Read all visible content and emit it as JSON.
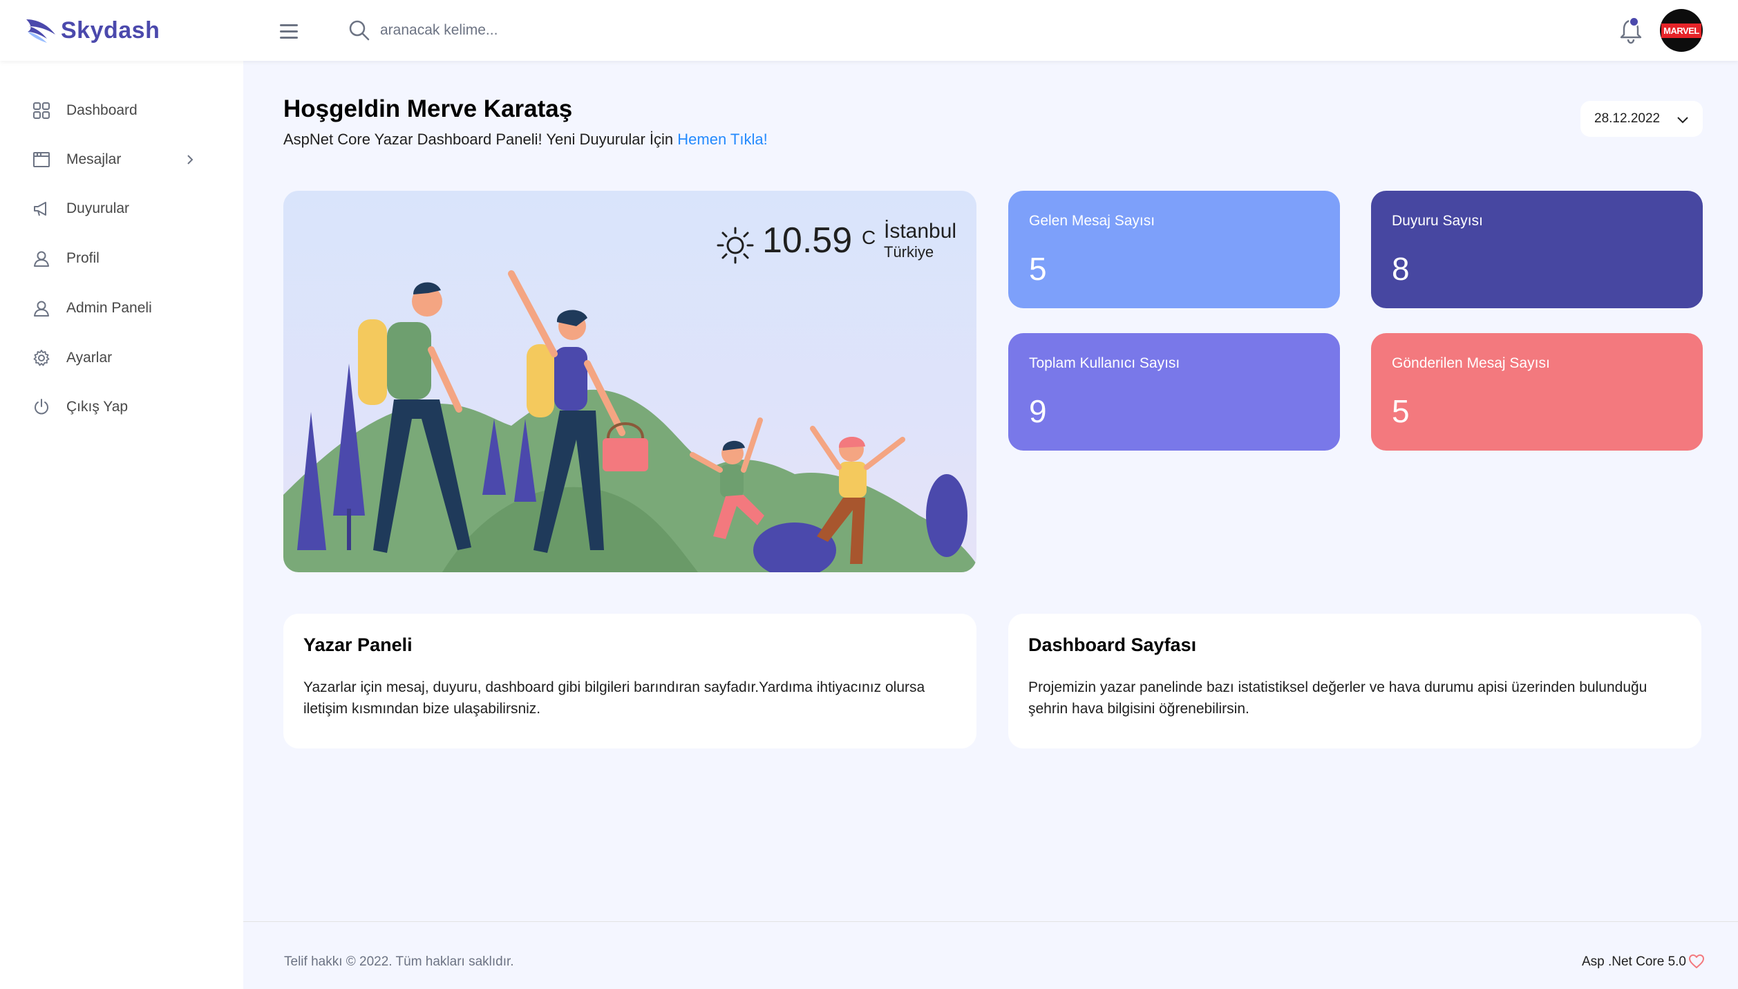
{
  "brand": {
    "name": "Skydash",
    "color": "#4b49ac"
  },
  "search": {
    "placeholder": "aranacak kelime..."
  },
  "avatar": {
    "badge": "MARVEL"
  },
  "sidebar": {
    "items": [
      {
        "label": "Dashboard",
        "icon": "grid-icon"
      },
      {
        "label": "Mesajlar",
        "icon": "browser-window-icon",
        "has_submenu": true
      },
      {
        "label": "Duyurular",
        "icon": "megaphone-icon"
      },
      {
        "label": "Profil",
        "icon": "user-icon"
      },
      {
        "label": "Admin Paneli",
        "icon": "user-icon"
      },
      {
        "label": "Ayarlar",
        "icon": "gear-icon"
      },
      {
        "label": "Çıkış Yap",
        "icon": "power-icon"
      }
    ]
  },
  "welcome": {
    "title": "Hoşgeldin Merve Karataş",
    "subtitle": "AspNet Core Yazar Dashboard Paneli! Yeni Duyurular İçin",
    "link": "Hemen Tıkla!"
  },
  "date": {
    "value": "28.12.2022"
  },
  "weather": {
    "temperature": "10.59",
    "unit": "C",
    "city": "İstanbul",
    "country": "Türkiye"
  },
  "stats": [
    {
      "label": "Gelen Mesaj Sayısı",
      "value": "5",
      "color": "#7da0fa"
    },
    {
      "label": "Duyuru Sayısı",
      "value": "8",
      "color": "#4747a1"
    },
    {
      "label": "Toplam Kullanıcı Sayısı",
      "value": "9",
      "color": "#7978e9"
    },
    {
      "label": "Gönderilen Mesaj Sayısı",
      "value": "5",
      "color": "#f3797e"
    }
  ],
  "info_cards": [
    {
      "title": "Yazar Paneli",
      "text": "Yazarlar için mesaj, duyuru, dashboard gibi bilgileri barındıran sayfadır.Yardıma ihtiyacınız olursa iletişim kısmından bize ulaşabilirsniz."
    },
    {
      "title": "Dashboard Sayfası",
      "text": "Projemizin yazar panelinde bazı istatistiksel değerler ve hava durumu apisi üzerinden bulunduğu şehrin hava bilgisini öğrenebilirsin."
    }
  ],
  "footer": {
    "copyright": "Telif hakkı © 2022. Tüm hakları saklıdır.",
    "tech": "Asp .Net Core 5.0"
  }
}
